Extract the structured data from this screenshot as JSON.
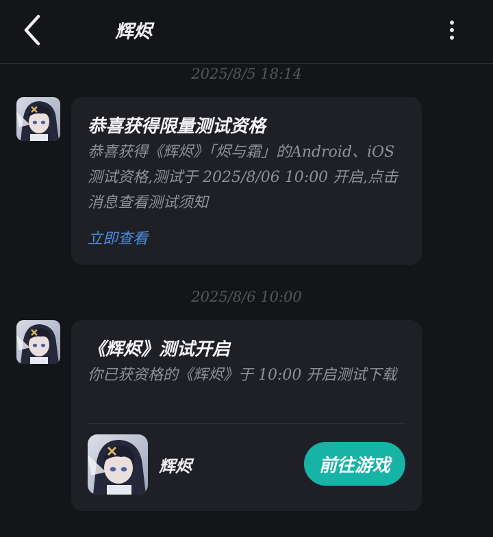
{
  "header": {
    "title": "辉烬",
    "back_icon": "chevron-left-icon",
    "more_icon": "more-vertical-icon"
  },
  "messages": [
    {
      "timestamp": "2025/8/5  18:14",
      "title": "恭喜获得限量测试资格",
      "body": "恭喜获得《辉烬》「烬与霜」的Android、iOS测试资格,测试于 2025/8/06 10:00 开启,点击消息查看测试须知",
      "link": "立即查看"
    },
    {
      "timestamp": "2025/8/6  10:00",
      "title": "《辉烬》测试开启",
      "body": "你已获资格的《辉烬》于 10:00 开启测试下载",
      "game": {
        "name": "辉烬",
        "button_label": "前往游戏"
      }
    }
  ],
  "colors": {
    "background": "#141518",
    "bubble": "#1f2026",
    "link": "#4a8de0",
    "accent": "#17b3a6",
    "muted": "#8f9196"
  }
}
